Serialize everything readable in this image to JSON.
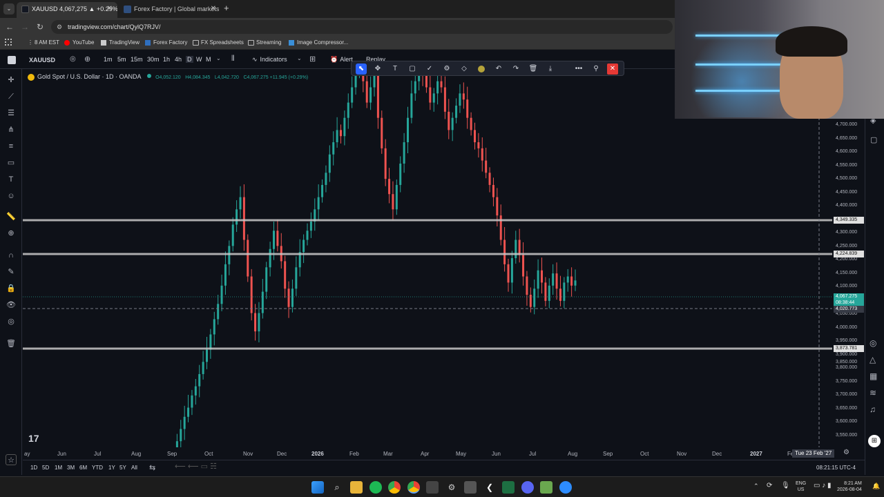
{
  "browser": {
    "tabs": [
      {
        "label": "XAUUSD 4,067,275 ▲ +0.29% ·",
        "active": true
      },
      {
        "label": "Forex Factory | Global markets fo",
        "active": false
      }
    ],
    "url": "tradingview.com/chart/QylQ7RJV/",
    "bookmarks": [
      "8 AM EST",
      "YouTube",
      "TradingView",
      "Forex Factory",
      "FX Spreadsheets",
      "Streaming",
      "Image Compressor..."
    ]
  },
  "tv": {
    "symbol": "XAUUSD",
    "timeframes": [
      "1m",
      "5m",
      "15m",
      "30m",
      "1h",
      "4h",
      "D",
      "W",
      "M"
    ],
    "active_timeframe": "D",
    "indicators_label": "Indicators",
    "alert_label": "Alert",
    "replay_label": "Replay",
    "legend": {
      "title": "Gold Spot / U.S. Dollar · 1D · OANDA",
      "o": "O4,052.120",
      "h": "H4,084.345",
      "l": "L4,042.720",
      "c": "C4,067.275 +11.945 (+0.29%)"
    },
    "price_labels": [
      "4,700.000",
      "4,650.000",
      "4,600.000",
      "4,550.000",
      "4,500.000",
      "4,450.000",
      "4,400.000",
      "4,300.000",
      "4,250.000",
      "4,200.000",
      "4,150.000",
      "4,100.000",
      "4,050.000",
      "4,000.000",
      "3,950.000",
      "3,900.000",
      "3,850.000",
      "3,800.000",
      "3,750.000",
      "3,700.000",
      "3,650.000",
      "3,600.000",
      "3,550.000"
    ],
    "price_tags": {
      "line1": "4,349.335",
      "line2": "4,224.839",
      "current": "4,067.275",
      "countdown": "08:38:44",
      "cursor": "4,020.773",
      "line3": "3,873.781"
    },
    "time_labels": [
      "ay",
      "Jun",
      "Jul",
      "Aug",
      "Sep",
      "Oct",
      "Nov",
      "Dec",
      "2026",
      "Feb",
      "Mar",
      "Apr",
      "May",
      "Jun",
      "Jul",
      "Aug",
      "Sep",
      "Oct",
      "Nov",
      "Dec",
      "2027",
      "Fe"
    ],
    "cursor_date": "Tue 23 Feb '27",
    "ranges": [
      "1D",
      "5D",
      "1M",
      "3M",
      "6M",
      "YTD",
      "1Y",
      "5Y",
      "All"
    ],
    "clock": "08:21:15 UTC-4",
    "watermark": "17"
  },
  "taskbar": {
    "lang": "ENG",
    "region": "US",
    "time": "8:21 AM",
    "date": "2026-08-04"
  },
  "colors": {
    "up": "#26a69a",
    "down": "#ef5350",
    "bg": "#0e1118",
    "hline": "#c8c8c8",
    "accent": "#2962ff"
  },
  "chart_data": {
    "type": "candlestick",
    "title": "Gold Spot / U.S. Dollar · 1D · OANDA",
    "ylim": [
      3520,
      4760
    ],
    "months": [
      "May",
      "Jun",
      "Jul",
      "Aug",
      "Sep",
      "Oct",
      "Nov",
      "Dec",
      "2026",
      "Feb",
      "Mar",
      "Apr",
      "May",
      "Jun",
      "Jul",
      "Aug",
      "Sep",
      "Oct",
      "Nov",
      "Dec",
      "2027",
      "Feb"
    ],
    "key_levels": [
      4349.335,
      4224.839,
      3873.781
    ],
    "last_close": 4067.275,
    "closes": [
      3500,
      3540,
      3580,
      3620,
      3650,
      3690,
      3720,
      3760,
      3800,
      3840,
      3890,
      3940,
      3990,
      4050,
      4120,
      4180,
      4250,
      4300,
      4340,
      4200,
      4080,
      3960,
      3900,
      3960,
      4030,
      4110,
      4170,
      4230,
      4180,
      4130,
      4040,
      3980,
      4040,
      4110,
      4160,
      4200,
      4230,
      4260,
      4300,
      4340,
      4380,
      4420,
      4480,
      4520,
      4560,
      4540,
      4600,
      4650,
      4700,
      4760,
      4790,
      4720,
      4650,
      4700,
      4780,
      4600,
      4500,
      4400,
      4350,
      4300,
      4380,
      4450,
      4520,
      4600,
      4680,
      4720,
      4760,
      4740,
      4700,
      4650,
      4680,
      4720,
      4700,
      4620,
      4560,
      4600,
      4640,
      4680,
      4660,
      4600,
      4560,
      4520,
      4500,
      4460,
      4420,
      4380,
      4340,
      4280,
      4200,
      4120,
      4060,
      4140,
      4200,
      4150,
      4080,
      4020,
      3980,
      4040,
      4100,
      4060,
      4000,
      4050,
      4090,
      4040,
      4000,
      4060,
      4080,
      4050,
      4067
    ]
  }
}
